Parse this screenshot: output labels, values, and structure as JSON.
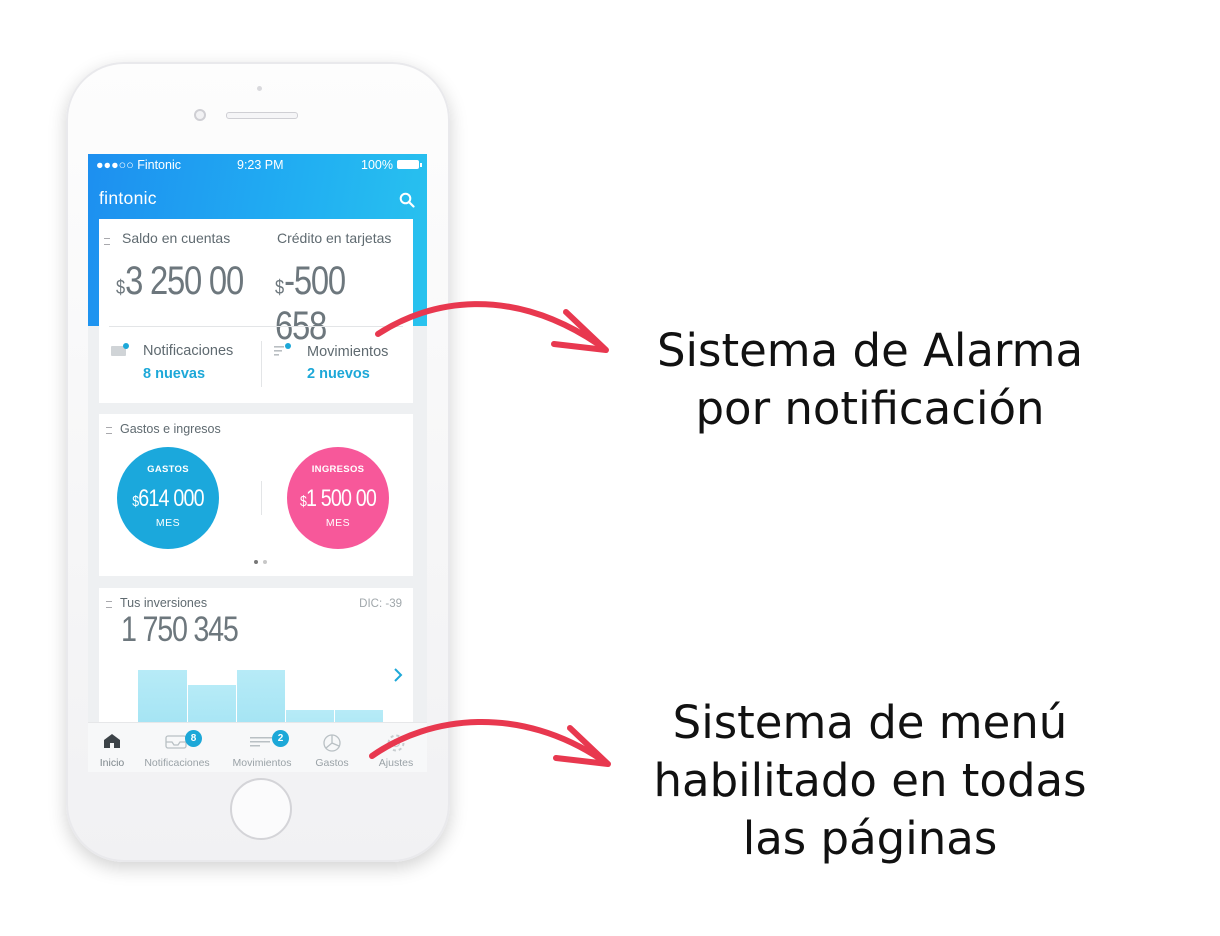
{
  "status_bar": {
    "carrier": "●●●○○ Fintonic",
    "time": "9:23 PM",
    "battery": "100%"
  },
  "app": {
    "brand": "fintonic"
  },
  "balances": {
    "accounts_label": "Saldo en cuentas",
    "accounts_currency": "$",
    "accounts_value": "3 250 00",
    "cards_label": "Crédito en tarjetas",
    "cards_currency": "$",
    "cards_value": "-500 658"
  },
  "shortcuts": {
    "notifications_label": "Notificaciones",
    "notifications_count": "8 nuevas",
    "movements_label": "Movimientos",
    "movements_count": "2 nuevos"
  },
  "expenses": {
    "title": "Gastos e ingresos",
    "gastos_title": "GASTOS",
    "gastos_currency": "$",
    "gastos_value": "614 000",
    "gastos_period": "MES",
    "ingresos_title": "INGRESOS",
    "ingresos_currency": "$",
    "ingresos_value": "1 500 00",
    "ingresos_period": "MES",
    "gastos_color": "#1ba8dc",
    "ingresos_color": "#f7589a"
  },
  "investments": {
    "title": "Tus inversiones",
    "period": "DIC: -39",
    "value": "1 750 345"
  },
  "bottom_nav": [
    {
      "label": "Inicio",
      "icon": "home-icon",
      "active": true
    },
    {
      "label": "Notificaciones",
      "icon": "inbox-icon",
      "badge": "8"
    },
    {
      "label": "Movimientos",
      "icon": "list-icon",
      "badge": "2"
    },
    {
      "label": "Gastos",
      "icon": "pie-chart-icon"
    },
    {
      "label": "Ajustes",
      "icon": "gear-icon"
    }
  ],
  "callouts": {
    "top_line1": "Sistema de Alarma",
    "top_line2": "por notificación",
    "bottom_line1": "Sistema de menú",
    "bottom_line2": "habilitado en todas",
    "bottom_line3": "las páginas"
  },
  "colors": {
    "accent": "#1da8d8",
    "arrow": "#e8384f"
  }
}
